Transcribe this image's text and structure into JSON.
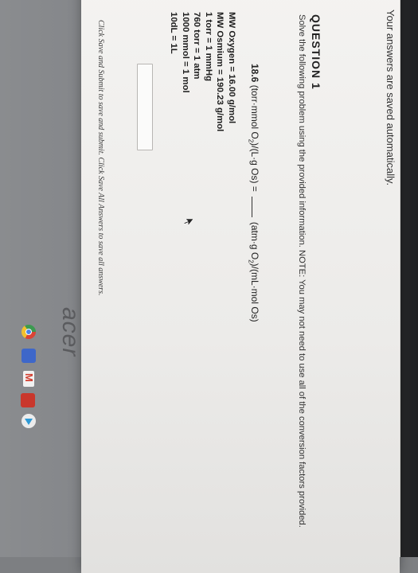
{
  "banner": {
    "saved_notice": "Your answers are saved automatically."
  },
  "question": {
    "title": "QUESTION 1",
    "instructions": "Solve the following problem using the provided information. NOTE: You may not need to use all of the conversion factors provided.",
    "problem_value": "18.6",
    "problem_units_left_pre": "(torr·mmol O",
    "problem_units_left_sub": "2",
    "problem_units_left_post": ")/(L·g Os) =",
    "problem_units_right_pre": "(atm·g O",
    "problem_units_right_sub": "2",
    "problem_units_right_post": ")/(mL·mol Os)"
  },
  "info": [
    "MW Oxygen = 16.00 g/mol",
    "MW Osmium = 190.23 g/mol",
    "1 torr = 1 mmHg",
    "760 torr = 1 atm",
    "1000 mmol = 1 mol",
    "10dL = 1L"
  ],
  "answer": {
    "value": ""
  },
  "footer": {
    "note": "Click Save and Submit to save and submit. Click Save All Answers to save all answers."
  },
  "device": {
    "brand": "acer"
  },
  "icons": [
    "chrome-icon",
    "files-icon",
    "gmail-icon",
    "app-icon",
    "play-store-icon"
  ]
}
